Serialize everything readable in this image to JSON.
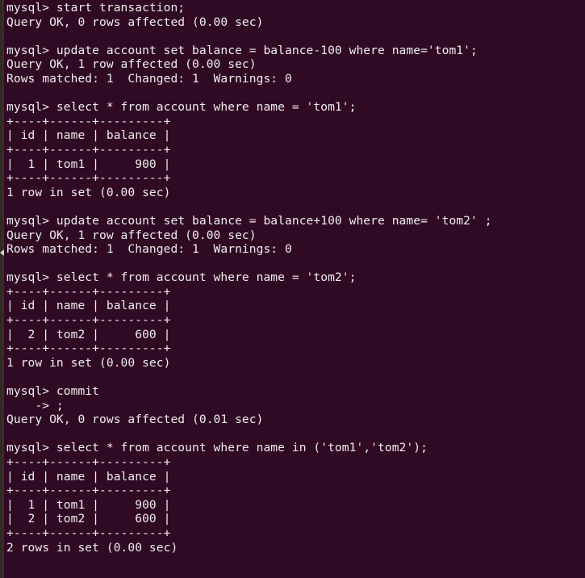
{
  "terminal": {
    "app": "gnome-terminal",
    "shell_prompt": "mysql>",
    "continuation_prompt": "    -> ",
    "colors": {
      "background": "#300a24",
      "foreground": "#eeeeec",
      "left_strip": "#2b2f1a",
      "left_border": "#4a2040"
    }
  },
  "session": {
    "lines": [
      "mysql> start transaction;",
      "Query OK, 0 rows affected (0.00 sec)",
      "",
      "mysql> update account set balance = balance-100 where name='tom1';",
      "Query OK, 1 row affected (0.00 sec)",
      "Rows matched: 1  Changed: 1  Warnings: 0",
      "",
      "mysql> select * from account where name = 'tom1';",
      "+----+------+---------+",
      "| id | name | balance |",
      "+----+------+---------+",
      "|  1 | tom1 |     900 |",
      "+----+------+---------+",
      "1 row in set (0.00 sec)",
      "",
      "mysql> update account set balance = balance+100 where name= 'tom2' ;",
      "Query OK, 1 row affected (0.00 sec)",
      "Rows matched: 1  Changed: 1  Warnings: 0",
      "",
      "mysql> select * from account where name = 'tom2';",
      "+----+------+---------+",
      "| id | name | balance |",
      "+----+------+---------+",
      "|  2 | tom2 |     600 |",
      "+----+------+---------+",
      "1 row in set (0.00 sec)",
      "",
      "mysql> commit",
      "    -> ;",
      "Query OK, 0 rows affected (0.01 sec)",
      "",
      "mysql> select * from account where name in ('tom1','tom2');",
      "+----+------+---------+",
      "| id | name | balance |",
      "+----+------+---------+",
      "|  1 | tom1 |     900 |",
      "|  2 | tom2 |     600 |",
      "+----+------+---------+",
      "2 rows in set (0.00 sec)"
    ]
  },
  "result_tables": [
    {
      "caption": "select * from account where name = 'tom1';",
      "columns": [
        "id",
        "name",
        "balance"
      ],
      "rows": [
        [
          "1",
          "tom1",
          "900"
        ]
      ],
      "footer": "1 row in set (0.00 sec)"
    },
    {
      "caption": "select * from account where name = 'tom2';",
      "columns": [
        "id",
        "name",
        "balance"
      ],
      "rows": [
        [
          "2",
          "tom2",
          "600"
        ]
      ],
      "footer": "1 row in set (0.00 sec)"
    },
    {
      "caption": "select * from account where name in ('tom1','tom2');",
      "columns": [
        "id",
        "name",
        "balance"
      ],
      "rows": [
        [
          "1",
          "tom1",
          "900"
        ],
        [
          "2",
          "tom2",
          "600"
        ]
      ],
      "footer": "2 rows in set (0.00 sec)"
    }
  ],
  "statuses": [
    "Query OK, 0 rows affected (0.00 sec)",
    "Query OK, 1 row affected (0.00 sec)",
    "Rows matched: 1  Changed: 1  Warnings: 0",
    "Query OK, 0 rows affected (0.01 sec)"
  ]
}
